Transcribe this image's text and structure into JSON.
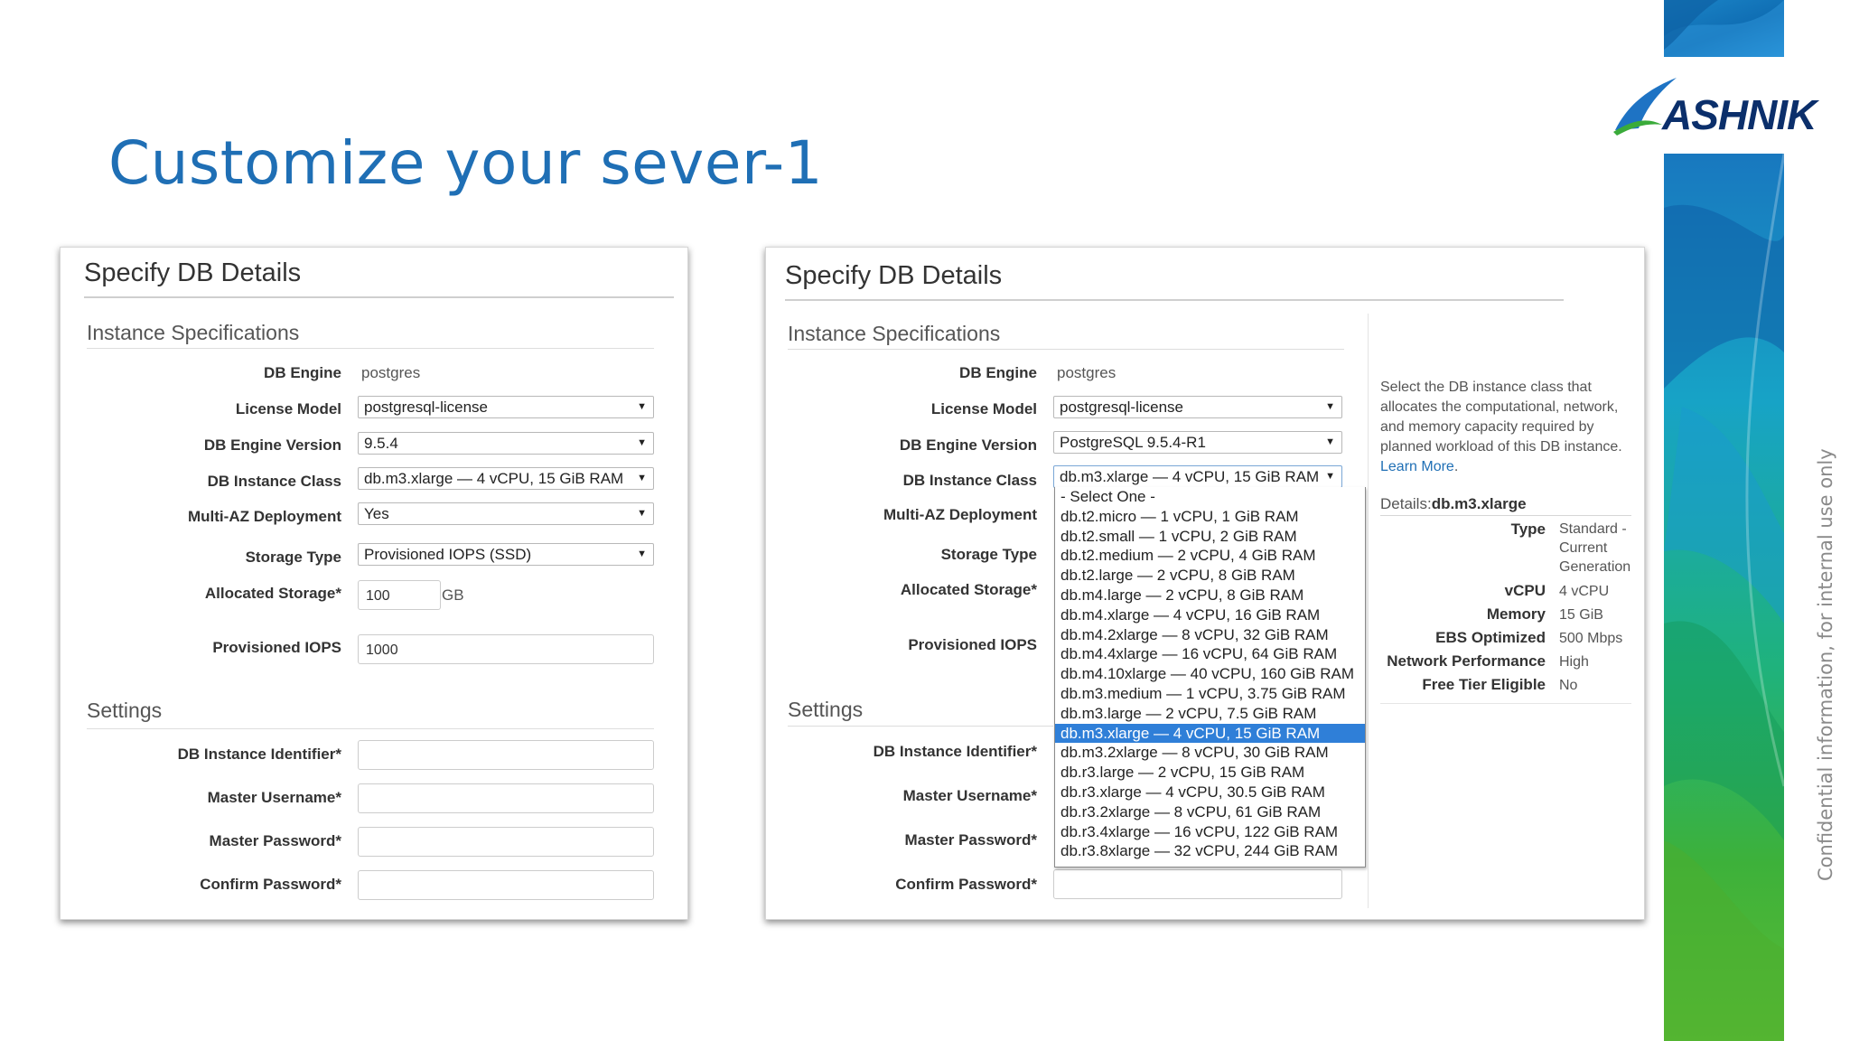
{
  "slide": {
    "title": "Customize your sever-1",
    "logo_text": "ASHNIK",
    "confidential": "Confidential information, for internal use only"
  },
  "left_panel": {
    "title": "Specify DB Details",
    "instance_section": "Instance Specifications",
    "db_engine_label": "DB Engine",
    "db_engine_value": "postgres",
    "license_model_label": "License Model",
    "license_model_value": "postgresql-license",
    "engine_version_label": "DB Engine Version",
    "engine_version_value": "9.5.4",
    "instance_class_label": "DB Instance Class",
    "instance_class_value": "db.m3.xlarge — 4 vCPU, 15 GiB RAM",
    "multi_az_label": "Multi-AZ Deployment",
    "multi_az_value": "Yes",
    "storage_type_label": "Storage Type",
    "storage_type_value": "Provisioned IOPS (SSD)",
    "allocated_storage_label": "Allocated Storage*",
    "allocated_storage_value": "100",
    "allocated_storage_unit": "GB",
    "iops_label": "Provisioned IOPS",
    "iops_value": "1000",
    "settings_section": "Settings",
    "identifier_label": "DB Instance Identifier*",
    "username_label": "Master Username*",
    "password_label": "Master Password*",
    "confirm_label": "Confirm Password*"
  },
  "right_panel": {
    "title": "Specify DB Details",
    "instance_section": "Instance Specifications",
    "db_engine_label": "DB Engine",
    "db_engine_value": "postgres",
    "license_model_label": "License Model",
    "license_model_value": "postgresql-license",
    "engine_version_label": "DB Engine Version",
    "engine_version_value": "PostgreSQL 9.5.4-R1",
    "instance_class_label": "DB Instance Class",
    "instance_class_value": "db.m3.xlarge — 4 vCPU, 15 GiB RAM",
    "multi_az_label": "Multi-AZ Deployment",
    "storage_type_label": "Storage Type",
    "allocated_storage_label": "Allocated Storage*",
    "iops_label": "Provisioned IOPS",
    "settings_section": "Settings",
    "identifier_label": "DB Instance Identifier*",
    "username_label": "Master Username*",
    "password_label": "Master Password*",
    "confirm_label": "Confirm Password*",
    "dropdown_options": [
      "- Select One -",
      "db.t2.micro — 1 vCPU, 1 GiB RAM",
      "db.t2.small — 1 vCPU, 2 GiB RAM",
      "db.t2.medium — 2 vCPU, 4 GiB RAM",
      "db.t2.large — 2 vCPU, 8 GiB RAM",
      "db.m4.large — 2 vCPU, 8 GiB RAM",
      "db.m4.xlarge — 4 vCPU, 16 GiB RAM",
      "db.m4.2xlarge — 8 vCPU, 32 GiB RAM",
      "db.m4.4xlarge — 16 vCPU, 64 GiB RAM",
      "db.m4.10xlarge — 40 vCPU, 160 GiB RAM",
      "db.m3.medium — 1 vCPU, 3.75 GiB RAM",
      "db.m3.large — 2 vCPU, 7.5 GiB RAM",
      "db.m3.xlarge — 4 vCPU, 15 GiB RAM",
      "db.m3.2xlarge — 8 vCPU, 30 GiB RAM",
      "db.r3.large — 2 vCPU, 15 GiB RAM",
      "db.r3.xlarge — 4 vCPU, 30.5 GiB RAM",
      "db.r3.2xlarge — 8 vCPU, 61 GiB RAM",
      "db.r3.4xlarge — 16 vCPU, 122 GiB RAM",
      "db.r3.8xlarge — 32 vCPU, 244 GiB RAM"
    ],
    "selected_option": "db.m3.xlarge — 4 vCPU, 15 GiB RAM",
    "help_text": "Select the DB instance class that allocates the computational, network, and memory capacity required by planned workload of this DB instance.",
    "help_link": "Learn More",
    "details_prefix": "Details:",
    "details_name": "db.m3.xlarge",
    "details": [
      {
        "key": "Type",
        "value": "Standard - Current Generation"
      },
      {
        "key": "vCPU",
        "value": "4 vCPU"
      },
      {
        "key": "Memory",
        "value": "15 GiB"
      },
      {
        "key": "EBS Optimized",
        "value": "500 Mbps"
      },
      {
        "key": "Network Performance",
        "value": "High"
      },
      {
        "key": "Free Tier Eligible",
        "value": "No"
      }
    ]
  },
  "colors": {
    "title_blue": "#1f6fb5",
    "selection_blue": "#2f7fd8",
    "logo_navy": "#0b2f6b"
  },
  "icons": [
    "dropdown-arrow-icon",
    "ashnik-logo-swoosh-icon"
  ]
}
